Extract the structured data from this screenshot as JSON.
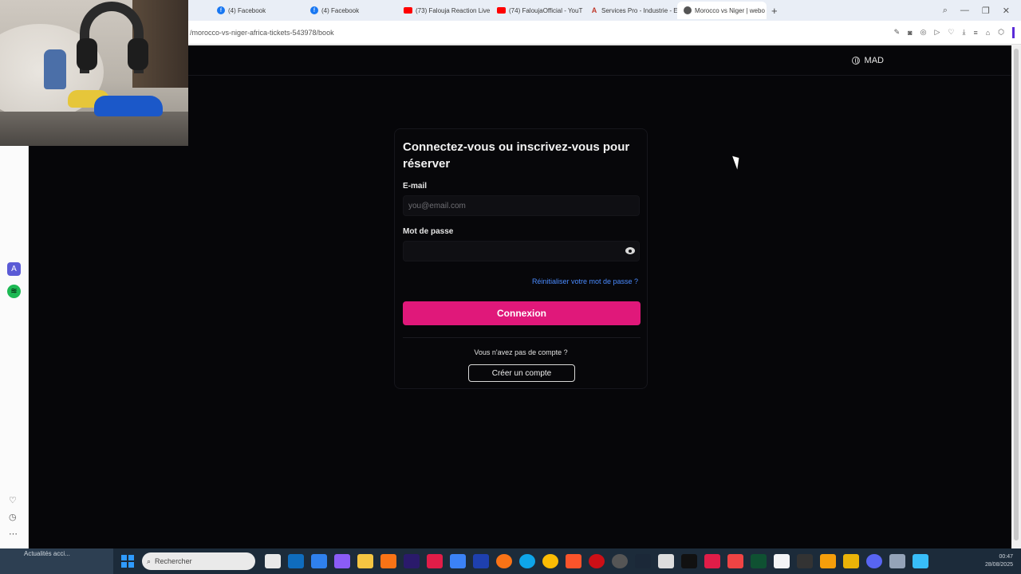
{
  "browser": {
    "tabs": [
      {
        "title": "(4) Facebook",
        "icon": "facebook-icon"
      },
      {
        "title": "(4) Facebook",
        "icon": "facebook-icon"
      },
      {
        "title": "(73) Falouja Reaction Live",
        "icon": "youtube-icon"
      },
      {
        "title": "(74) FaloujaOfficial - YouT",
        "icon": "youtube-icon"
      },
      {
        "title": "Services Pro - Industrie - E",
        "icon": "services-icon"
      },
      {
        "title": "Morocco vs Niger | webo",
        "icon": "globe-icon",
        "active": true
      }
    ],
    "new_tab": "+",
    "url": "/morocco-vs-niger-africa-tickets-543978/book"
  },
  "header": {
    "currency": "MAD"
  },
  "login": {
    "title": "Connectez-vous ou inscrivez-vous pour réserver",
    "email_label": "E-mail",
    "email_placeholder": "you@email.com",
    "password_label": "Mot de passe",
    "forgot_link": "Réinitialiser votre mot de passe ?",
    "login_button": "Connexion",
    "no_account_text": "Vous n'avez pas de compte ?",
    "create_account_button": "Créer un compte",
    "accent_color": "#e0187a"
  },
  "taskbar": {
    "news": "Actualités acci...",
    "search_placeholder": "Rechercher",
    "time": "00:47",
    "date": "28/08/2025"
  }
}
